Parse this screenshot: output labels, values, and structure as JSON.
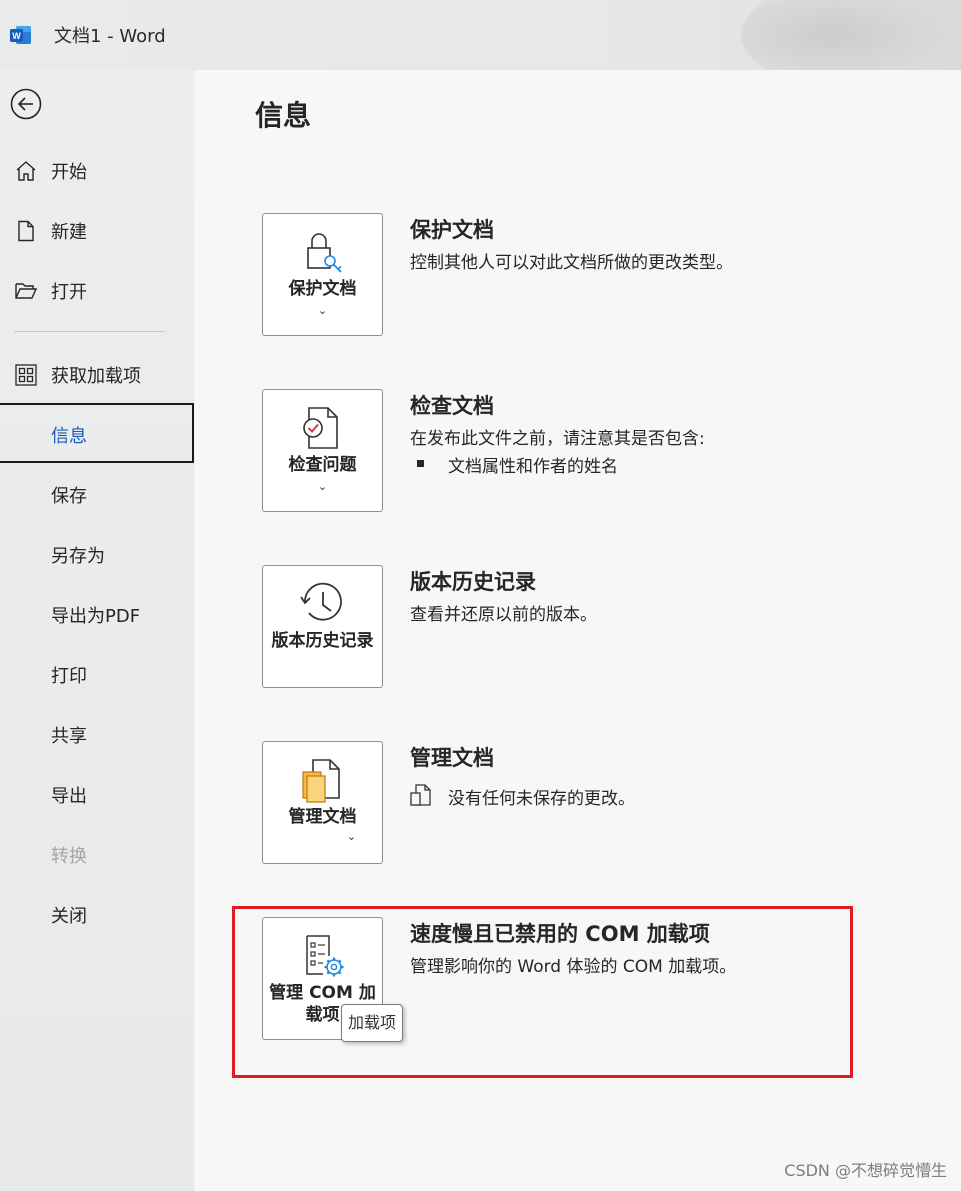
{
  "window": {
    "title": "文档1  -  Word",
    "app_icon": "word-logo-icon",
    "accent": "#185abd"
  },
  "sidebar": {
    "back_icon": "back-arrow-icon",
    "items": [
      {
        "label": "开始",
        "icon": "home-icon"
      },
      {
        "label": "新建",
        "icon": "new-document-icon"
      },
      {
        "label": "打开",
        "icon": "open-folder-icon"
      },
      {
        "label": "获取加载项",
        "icon": "grid-icon"
      },
      {
        "label": "信息",
        "selected": true
      },
      {
        "label": "保存"
      },
      {
        "label": "另存为"
      },
      {
        "label": "导出为PDF"
      },
      {
        "label": "打印"
      },
      {
        "label": "共享"
      },
      {
        "label": "导出"
      },
      {
        "label": "转换",
        "disabled": true
      },
      {
        "label": "关闭"
      }
    ]
  },
  "main": {
    "title": "信息",
    "sections": [
      {
        "button_label": "保护文档",
        "button_icon": "lock-key-icon",
        "has_dropdown": true,
        "title": "保护文档",
        "description": "控制其他人可以对此文档所做的更改类型。"
      },
      {
        "button_label": "检查问题",
        "button_icon": "inspect-document-icon",
        "has_dropdown": true,
        "title": "检查文档",
        "description": "在发布此文件之前，请注意其是否包含:",
        "bullets": [
          "文档属性和作者的姓名"
        ]
      },
      {
        "button_label": "版本历史记录",
        "button_icon": "history-clock-icon",
        "has_dropdown": false,
        "title": "版本历史记录",
        "description": "查看并还原以前的版本。"
      },
      {
        "button_label": "管理文档",
        "button_icon": "manage-document-icon",
        "has_dropdown": true,
        "title": "管理文档",
        "description": "没有任何未保存的更改。",
        "desc_icon": "unsaved-changes-icon"
      },
      {
        "button_label": "管理 COM 加载项",
        "button_icon": "com-addin-gear-icon",
        "has_dropdown": false,
        "title": "速度慢且已禁用的 COM 加载项",
        "description": "管理影响你的 Word 体验的 COM 加载项。",
        "highlight_color": "#e11b22"
      }
    ],
    "tooltip": "加载项"
  },
  "watermark": "CSDN @不想碎觉懵生"
}
